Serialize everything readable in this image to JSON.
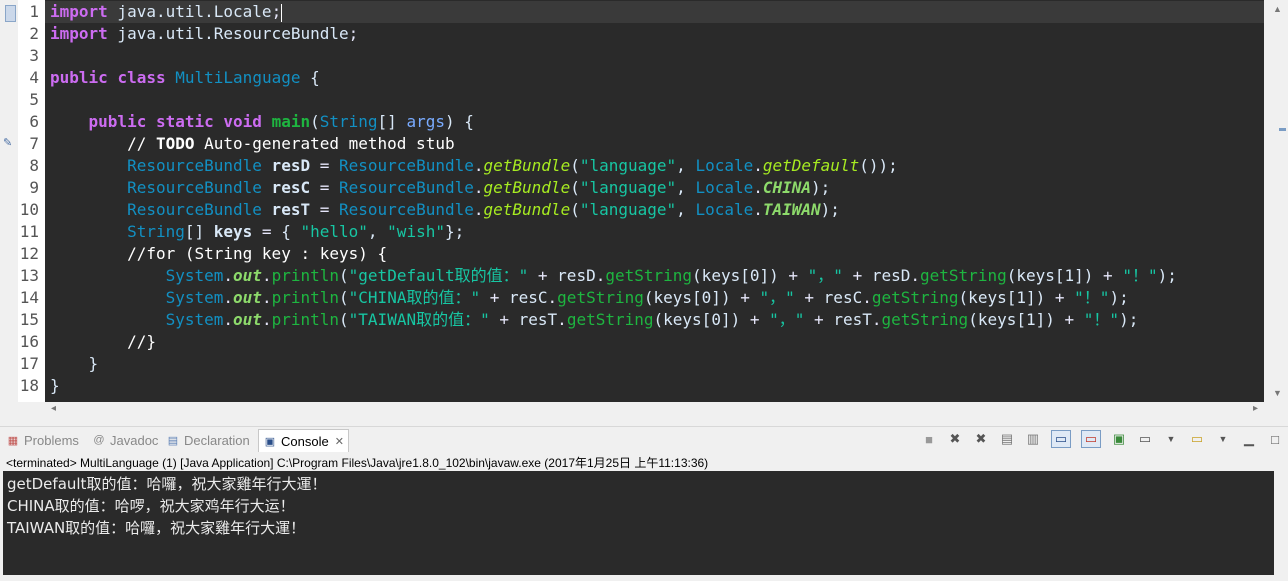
{
  "editor": {
    "line_numbers": [
      "1",
      "2",
      "3",
      "4",
      "5",
      "6",
      "7",
      "8",
      "9",
      "10",
      "11",
      "12",
      "13",
      "14",
      "15",
      "16",
      "17",
      "18"
    ],
    "code": {
      "l1": {
        "kw": "import",
        "pkg": " java.util.Locale",
        "semi": ";"
      },
      "l2": {
        "kw": "import",
        "pkg": " java.util.ResourceBundle",
        "semi": ";"
      },
      "l4": {
        "kw1": "public",
        "kw2": "class",
        "name": "MultiLanguage",
        "brace": " {"
      },
      "l6": {
        "kw1": "public",
        "kw2": "static",
        "kw3": "void",
        "name": "main",
        "p1": "(",
        "type": "String",
        "p2": "[] ",
        "arg": "args",
        "p3": ") {"
      },
      "l7": {
        "c1": "// ",
        "todo": "TODO",
        "c2": " Auto-generated method stub"
      },
      "l8": {
        "t": "ResourceBundle",
        "v": " resD",
        "eq": " = ",
        "cls": "ResourceBundle",
        "dot": ".",
        "m": "getBundle",
        "p1": "(",
        "s": "\"language\"",
        "c": ", ",
        "cls2": "Locale",
        "dot2": ".",
        "m2": "getDefault",
        "p2": "());"
      },
      "l9": {
        "t": "ResourceBundle",
        "v": " resC",
        "eq": " = ",
        "cls": "ResourceBundle",
        "dot": ".",
        "m": "getBundle",
        "p1": "(",
        "s": "\"language\"",
        "c": ", ",
        "cls2": "Locale",
        "dot2": ".",
        "f": "CHINA",
        "p2": ");"
      },
      "l10": {
        "t": "ResourceBundle",
        "v": " resT",
        "eq": " = ",
        "cls": "ResourceBundle",
        "dot": ".",
        "m": "getBundle",
        "p1": "(",
        "s": "\"language\"",
        "c": ", ",
        "cls2": "Locale",
        "dot2": ".",
        "f": "TAIWAN",
        "p2": ");"
      },
      "l11": {
        "t": "String",
        "p1": "[] ",
        "v": "keys",
        "eq": " = ",
        "b1": "{ ",
        "s1": "\"hello\"",
        "c": ", ",
        "s2": "\"wish\"",
        "b2": "};"
      },
      "l12": {
        "cm": "//for (String key : keys) {"
      },
      "l13": {
        "cls": "System",
        "d1": ".",
        "f": "out",
        "d2": ".",
        "m": "println",
        "p1": "(",
        "s1": "\"getDefault取的值：\"",
        "pl1": " + ",
        "v1": "resD",
        "d3": ".",
        "m1": "getString",
        "a1": "(keys[0])",
        "pl2": " + ",
        "s2": "\"，\"",
        "pl3": " + ",
        "v2": "resD",
        "d4": ".",
        "m2": "getString",
        "a2": "(keys[1])",
        "pl4": " + ",
        "s3": "\"！\"",
        "end": ");"
      },
      "l14": {
        "cls": "System",
        "d1": ".",
        "f": "out",
        "d2": ".",
        "m": "println",
        "p1": "(",
        "s1": "\"CHINA取的值：\"",
        "pl1": " + ",
        "v1": "resC",
        "d3": ".",
        "m1": "getString",
        "a1": "(keys[0])",
        "pl2": " + ",
        "s2": "\"，\"",
        "pl3": " + ",
        "v2": "resC",
        "d4": ".",
        "m2": "getString",
        "a2": "(keys[1])",
        "pl4": " + ",
        "s3": "\"！\"",
        "end": ");"
      },
      "l15": {
        "cls": "System",
        "d1": ".",
        "f": "out",
        "d2": ".",
        "m": "println",
        "p1": "(",
        "s1": "\"TAIWAN取的值：\"",
        "pl1": " + ",
        "v1": "resT",
        "d3": ".",
        "m1": "getString",
        "a1": "(keys[0])",
        "pl2": " + ",
        "s2": "\"，\"",
        "pl3": " + ",
        "v2": "resT",
        "d4": ".",
        "m2": "getString",
        "a2": "(keys[1])",
        "pl4": " + ",
        "s3": "\"！\"",
        "end": ");"
      },
      "l16": {
        "cm": "//}"
      },
      "l17": {
        "b": "}"
      },
      "l18": {
        "b": "}"
      }
    }
  },
  "views": {
    "tabs": [
      {
        "label": "Problems",
        "icon": "problems-icon"
      },
      {
        "label": "Javadoc",
        "icon": "at-icon"
      },
      {
        "label": "Declaration",
        "icon": "declaration-icon"
      },
      {
        "label": "Console",
        "icon": "console-icon",
        "active": true
      }
    ],
    "close_glyph": "✕"
  },
  "console": {
    "launch": "<terminated> MultiLanguage (1) [Java Application] C:\\Program Files\\Java\\jre1.8.0_102\\bin\\javaw.exe (2017年1月25日 上午11:13:36)",
    "output": [
      "getDefault取的值：哈囉，祝大家雞年行大運！",
      "CHINA取的值：哈啰，祝大家鸡年行大运！",
      "TAIWAN取的值：哈囉，祝大家雞年行大運！"
    ]
  }
}
